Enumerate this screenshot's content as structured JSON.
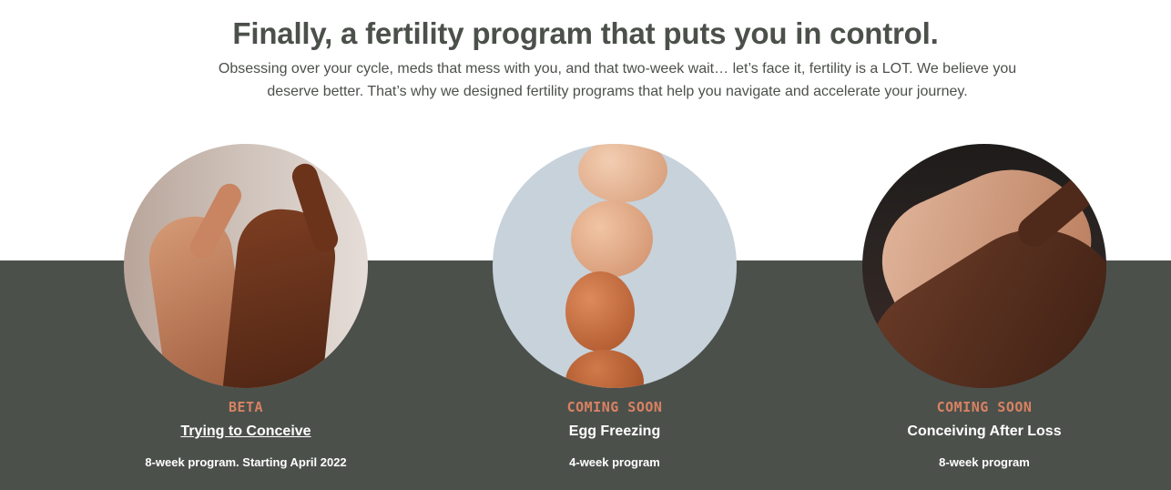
{
  "header": {
    "title": "Finally, a fertility program that puts you in control.",
    "intro": "Obsessing over your cycle, meds that mess with you, and that two-week wait… let’s face it, fertility is a LOT. We believe you deserve better. That’s why we designed fertility programs that help you navigate and accelerate your journey."
  },
  "programs": [
    {
      "status": "BETA",
      "title": "Trying to Conceive",
      "details": "8-week program. Starting April 2022",
      "image": "hands-pinky-promise-photo"
    },
    {
      "status": "COMING SOON",
      "title": "Egg Freezing",
      "details": "4-week program",
      "image": "stacked-eggs-photo"
    },
    {
      "status": "COMING SOON",
      "title": "Conceiving After Loss",
      "details": "8-week program",
      "image": "holding-hands-photo"
    }
  ],
  "colors": {
    "band_background": "#4c504b",
    "status_accent": "#d98262",
    "heading_text": "#4c504b"
  }
}
